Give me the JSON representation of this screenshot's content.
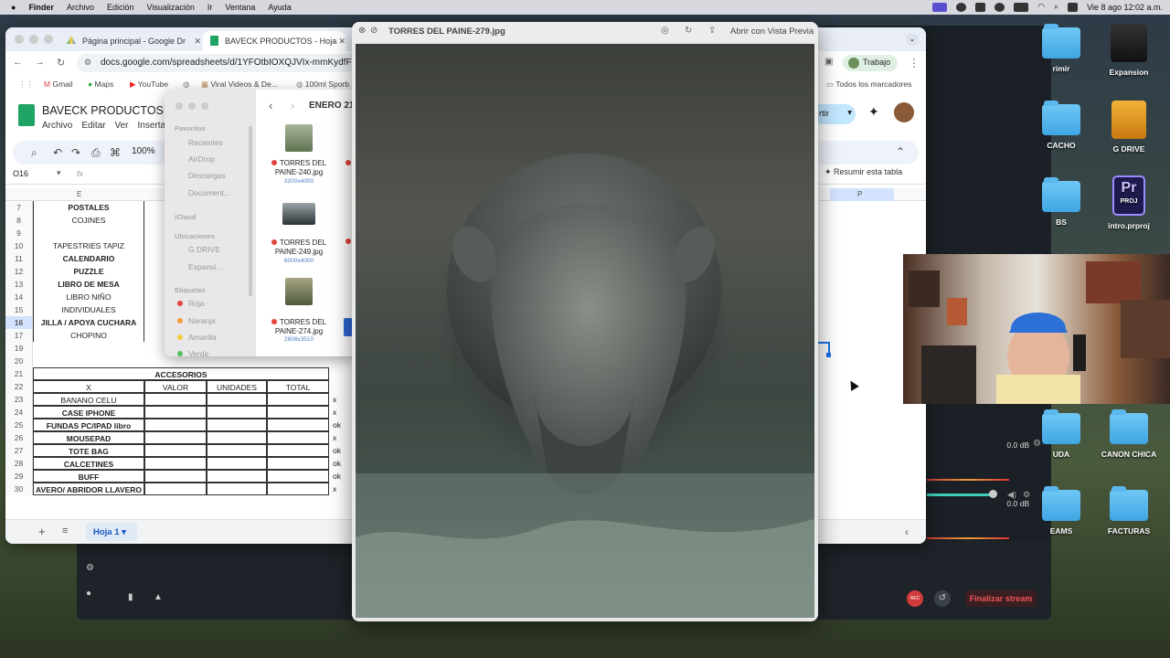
{
  "menubar": {
    "app": "Finder",
    "items": [
      "Archivo",
      "Edición",
      "Visualización",
      "Ir",
      "Ventana",
      "Ayuda"
    ],
    "clock": "Vie 8 ago 12:02 a.m."
  },
  "desktop": {
    "icons": [
      "rimir",
      "Expansion",
      "CACHO",
      "G DRIVE",
      "BS",
      "intro.prproj",
      "UDA",
      "CANON CHICA",
      "EAMS",
      "FACTURAS"
    ],
    "proj_badge_top": "Pr",
    "proj_badge_bottom": "PROJ"
  },
  "chrome": {
    "tabs": [
      {
        "label": "Página principal - Google Dr"
      },
      {
        "label": "BAVECK PRODUCTOS - Hoja"
      }
    ],
    "url": "docs.google.com/spreadsheets/d/1YFOtbIOXQJVIx-mmKydfFd",
    "profile_label": "Trabajo",
    "bookmarks": [
      "Gmail",
      "Maps",
      "YouTube",
      "Viral Videos & De...",
      "100ml Sporb"
    ],
    "all_bookmarks": "Todos los marcadores"
  },
  "sheet": {
    "title": "BAVECK PRODUCTOS",
    "menu": [
      "Archivo",
      "Editar",
      "Ver",
      "Insertar"
    ],
    "zoom": "100%",
    "cell_ref": "O16",
    "fx": "fx",
    "col_E": "E",
    "col_P": "P",
    "share_label": "rtir",
    "summarize": "Resumir esta tabla",
    "rows_top": [
      {
        "n": "7",
        "e": "POSTALES",
        "bold": true
      },
      {
        "n": "8",
        "e": "COJINES",
        "bold": false
      },
      {
        "n": "9",
        "e": "",
        "bold": false
      },
      {
        "n": "10",
        "e": "TAPESTRIES TAPIZ",
        "bold": false
      },
      {
        "n": "11",
        "e": "CALENDARIO",
        "bold": true
      },
      {
        "n": "12",
        "e": "PUZZLE",
        "bold": true
      },
      {
        "n": "13",
        "e": "LIBRO DE MESA",
        "bold": true
      },
      {
        "n": "14",
        "e": "LIBRO NIÑO",
        "bold": false
      },
      {
        "n": "15",
        "e": "INDIVIDUALES",
        "bold": false
      },
      {
        "n": "16",
        "e": "JILLA / APOYA CUCHARA",
        "bold": true
      },
      {
        "n": "17",
        "e": "CHOPINO",
        "bold": false
      },
      {
        "n": "19",
        "e": "",
        "bold": false
      },
      {
        "n": "20",
        "e": "",
        "bold": false
      }
    ],
    "accesorios": {
      "header_row": "21",
      "title": "ACCESORIOS",
      "col_row": "22",
      "cols": [
        "X",
        "VALOR",
        "UNIDADES",
        "TOTAL"
      ],
      "items": [
        {
          "n": "23",
          "name": "BANANO CELU",
          "bold": false,
          "mark": "x"
        },
        {
          "n": "24",
          "name": "CASE IPHONE",
          "bold": true,
          "mark": "x"
        },
        {
          "n": "25",
          "name": "FUNDAS PC/IPAD libro",
          "bold": true,
          "mark": "ok"
        },
        {
          "n": "26",
          "name": "MOUSEPAD",
          "bold": true,
          "mark": "x"
        },
        {
          "n": "27",
          "name": "TOTE BAG",
          "bold": true,
          "mark": "ok"
        },
        {
          "n": "28",
          "name": "CALCETINES",
          "bold": true,
          "mark": "ok"
        },
        {
          "n": "29",
          "name": "BUFF",
          "bold": true,
          "mark": "ok"
        },
        {
          "n": "30",
          "name": "AVERO/ ABRIDOR LLAVERO",
          "bold": true,
          "mark": "x"
        }
      ]
    },
    "sheet_tab": "Hoja 1"
  },
  "finder": {
    "path": "ENERO 21",
    "favoritos": "Favoritos",
    "fav_items": [
      "Recientes",
      "AirDrop",
      "Descargas",
      "Document..."
    ],
    "icloud": "iCloud",
    "ubicaciones": "Ubicaciones",
    "loc_items": [
      "G DRIVE",
      "Expansi..."
    ],
    "etiquetas": "Etiquetas",
    "tag_items": [
      "Roja",
      "Naranja",
      "Amarilla",
      "Verde"
    ],
    "files": [
      {
        "name": "TORRES DEL PAINE-240.jpg",
        "dim": "3200x4000"
      },
      {
        "name": "TORRES DEL PAINE-249.jpg",
        "dim": "6000x4000"
      },
      {
        "name": "TORRES DEL PAINE-274.jpg",
        "dim": "2808x3510"
      }
    ]
  },
  "preview": {
    "filename": "TORRES DEL PAINE-279.jpg",
    "open_label": "Abrir con Vista Previa"
  },
  "obs": {
    "db1": "0.0 dB",
    "db2": "0.0 dB",
    "end_stream": "Finalizar stream",
    "rec": "REC"
  }
}
